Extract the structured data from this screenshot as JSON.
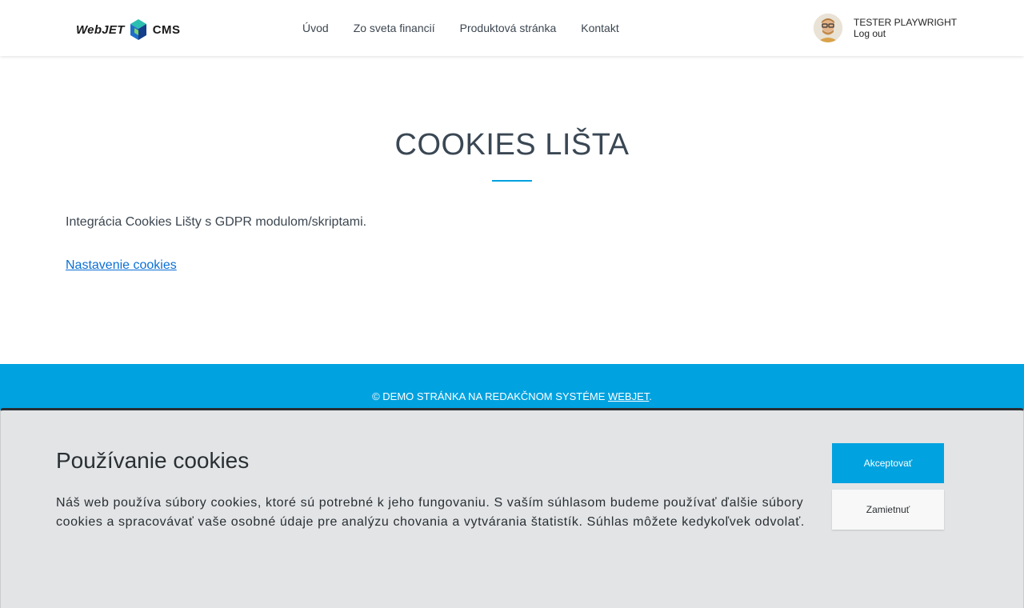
{
  "header": {
    "logo_left": "WebJET",
    "logo_right": "CMS",
    "nav": [
      {
        "label": "Úvod"
      },
      {
        "label": "Zo sveta financií"
      },
      {
        "label": "Produktová stránka"
      },
      {
        "label": "Kontakt"
      }
    ],
    "user": {
      "name": "TESTER PLAYWRIGHT",
      "logout": "Log out"
    }
  },
  "main": {
    "title": "COOKIES LIŠTA",
    "intro": "Integrácia Cookies Lišty s GDPR modulom/skriptami.",
    "cookie_settings_link": "Nastavenie cookies"
  },
  "footer": {
    "text_prefix": "© DEMO STRÁNKA NA REDAKČNOM SYSTÉME ",
    "link": "WEBJET",
    "text_suffix": "."
  },
  "cookie_bar": {
    "title": "Používanie cookies",
    "text": "Náš web používa súbory cookies, ktoré sú potrebné k jeho fungovaniu. S vaším súhlasom budeme používať ďalšie súbory cookies a spracovávať vaše osobné údaje pre analýzu chovania a vytvárania štatistík. Súhlas môžete kedykoľvek odvolať.",
    "accept_label": "Akceptovať",
    "reject_label": "Zamietnuť"
  },
  "colors": {
    "accent": "#00a2e0",
    "link": "#0a6fd6",
    "cookie_bar_bg": "#e2e4e6"
  }
}
